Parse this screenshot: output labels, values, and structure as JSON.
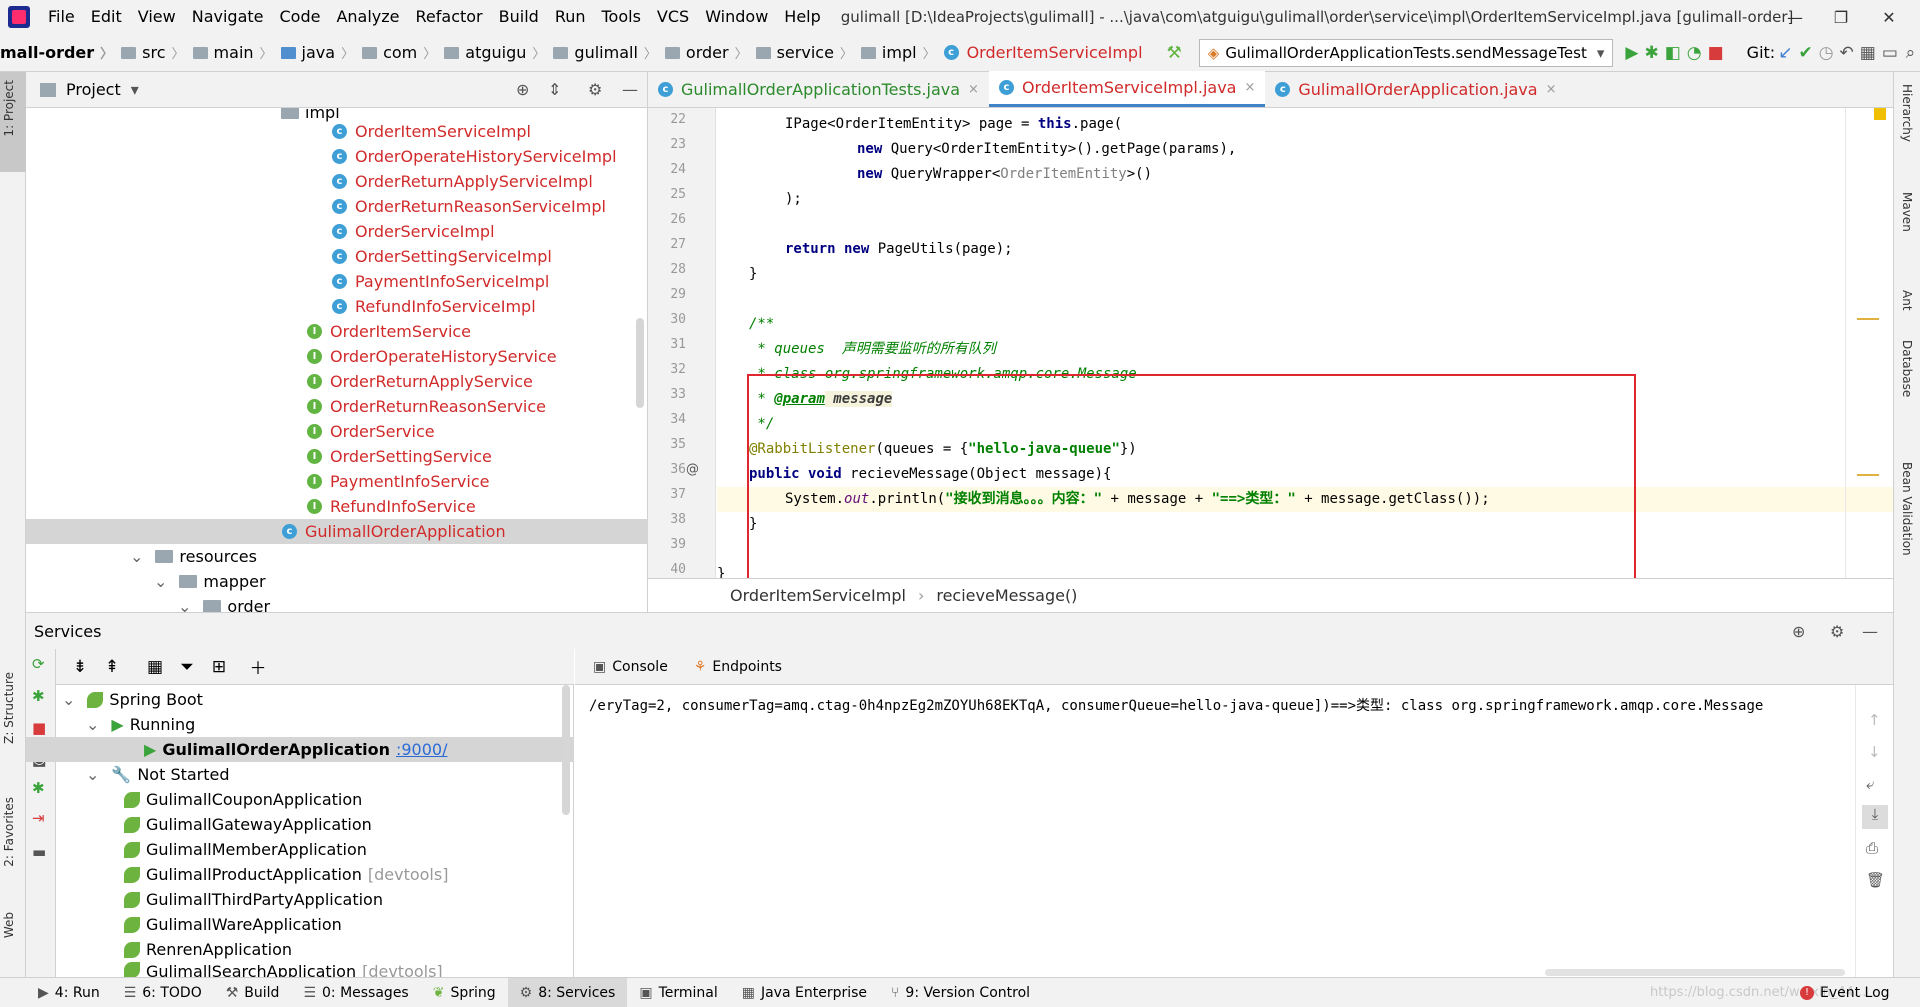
{
  "menubar": {
    "items": [
      "File",
      "Edit",
      "View",
      "Navigate",
      "Code",
      "Analyze",
      "Refactor",
      "Build",
      "Run",
      "Tools",
      "VCS",
      "Window",
      "Help"
    ],
    "title": "gulimall [D:\\IdeaProjects\\gulimall] - ...\\java\\com\\atguigu\\gulimall\\order\\service\\impl\\OrderItemServiceImpl.java [gulimall-order]"
  },
  "navbar": {
    "crumbs": [
      "mall-order",
      "src",
      "main",
      "java",
      "com",
      "atguigu",
      "gulimall",
      "order",
      "service",
      "impl",
      "OrderItemServiceImpl"
    ],
    "run_config": "GulimallOrderApplicationTests.sendMessageTest",
    "git_label": "Git:"
  },
  "left_tabs": {
    "project": "1: Project",
    "structure": "Z: Structure",
    "favorites": "2: Favorites",
    "web": "Web"
  },
  "right_tabs": {
    "hierarchy": "Hierarchy",
    "maven": "Maven",
    "ant": "Ant",
    "database": "Database",
    "bean": "Bean Validation"
  },
  "project": {
    "header": "Project",
    "rows": [
      {
        "text": "impl",
        "type": "folder"
      },
      {
        "text": "OrderItemServiceImpl",
        "type": "class"
      },
      {
        "text": "OrderOperateHistoryServiceImpl",
        "type": "class"
      },
      {
        "text": "OrderReturnApplyServiceImpl",
        "type": "class"
      },
      {
        "text": "OrderReturnReasonServiceImpl",
        "type": "class"
      },
      {
        "text": "OrderServiceImpl",
        "type": "class"
      },
      {
        "text": "OrderSettingServiceImpl",
        "type": "class"
      },
      {
        "text": "PaymentInfoServiceImpl",
        "type": "class"
      },
      {
        "text": "RefundInfoServiceImpl",
        "type": "class"
      },
      {
        "text": "OrderItemService",
        "type": "interface"
      },
      {
        "text": "OrderOperateHistoryService",
        "type": "interface"
      },
      {
        "text": "OrderReturnApplyService",
        "type": "interface"
      },
      {
        "text": "OrderReturnReasonService",
        "type": "interface"
      },
      {
        "text": "OrderService",
        "type": "interface"
      },
      {
        "text": "OrderSettingService",
        "type": "interface"
      },
      {
        "text": "PaymentInfoService",
        "type": "interface"
      },
      {
        "text": "RefundInfoService",
        "type": "interface"
      },
      {
        "text": "GulimallOrderApplication",
        "type": "app"
      },
      {
        "text": "resources",
        "type": "folder"
      },
      {
        "text": "mapper",
        "type": "folder"
      },
      {
        "text": "order",
        "type": "folder"
      }
    ]
  },
  "editor": {
    "tabs": [
      {
        "label": "GulimallOrderApplicationTests.java",
        "close": "×"
      },
      {
        "label": "OrderItemServiceImpl.java",
        "close": "×"
      },
      {
        "label": "GulimallOrderApplication.java",
        "close": "×"
      }
    ],
    "line_numbers": [
      "22",
      "23",
      "24",
      "25",
      "26",
      "27",
      "28",
      "29",
      "30",
      "31",
      "32",
      "33",
      "34",
      "35",
      "36",
      "37",
      "38",
      "39",
      "40"
    ],
    "code": {
      "l22a": "IPage<OrderItemEntity> page = ",
      "l22b": "this",
      ".l22c": "",
      "l22c": ".page(",
      "l23a": "new ",
      "l23b": "Query<OrderItemEntity>().getPage(params),",
      "l24a": "new ",
      "l24b": "QueryWrapper<",
      "l24c": "OrderItemEntity",
      "l24d": ">()",
      "l25": ");",
      "l27a": "return new ",
      "l27b": "PageUtils(page);",
      "l28": "}",
      "l30": "/**",
      "l31": " * queues  声明需要监听的所有队列",
      "l32": " * class org.springframework.amqp.core.Message",
      "l33a": " * ",
      "l33b": "@param",
      " l33c": "",
      "l33c": " message",
      "l34": " */",
      "l35a": "@RabbitListener",
      "l35b": "(queues = {",
      "l35c": "\"hello-java-queue\"",
      "l35d": "})",
      "l36a": "public void ",
      "l36b": "recieveMessage(Object message){",
      "l37a": "System.",
      "l37b": "out",
      "l37c": ".println(",
      "l37d": "\"接收到消息。。。内容：\"",
      "l37e": " + message + ",
      "l37f": "\"==>类型：\"",
      "l37g": " + message.getClass());",
      "l38": "}",
      "l40": "}"
    },
    "breadcrumb": [
      "OrderItemServiceImpl",
      "recieveMessage()"
    ],
    "gutter_marks": {
      "at": "@"
    }
  },
  "services": {
    "title": "Services",
    "tree": {
      "spring_boot": "Spring Boot",
      "running": "Running",
      "running_app": "GulimallOrderApplication",
      "running_port": ":9000/",
      "not_started": "Not Started",
      "apps": [
        {
          "name": "GulimallCouponApplication",
          "tag": ""
        },
        {
          "name": "GulimallGatewayApplication",
          "tag": ""
        },
        {
          "name": "GulimallMemberApplication",
          "tag": ""
        },
        {
          "name": "GulimallProductApplication",
          "tag": "[devtools]"
        },
        {
          "name": "GulimallThirdPartyApplication",
          "tag": ""
        },
        {
          "name": "GulimallWareApplication",
          "tag": ""
        },
        {
          "name": "RenrenApplication",
          "tag": ""
        },
        {
          "name": "GulimallSearchApplication",
          "tag": "[devtools]"
        }
      ]
    },
    "console_tabs": [
      "Console",
      "Endpoints"
    ],
    "console_line": "/eryTag=2, consumerTag=amq.ctag-0h4npzEg2mZOYUh68EKTqA, consumerQueue=hello-java-queue])==>类型: class org.springframework.amqp.core.Message"
  },
  "bottombar": {
    "tabs": [
      "4: Run",
      "6: TODO",
      "Build",
      "0: Messages",
      "Spring",
      "8: Services",
      "Terminal",
      "Java Enterprise",
      "9: Version Control"
    ],
    "event_log": "Event Log",
    "watermark": "https://blog.csdn.net/weixin_44..."
  },
  "colors": {
    "highlight_box": "#e0262e",
    "active_tab": "#4083c9",
    "selected_row": "#d5d5d5"
  }
}
